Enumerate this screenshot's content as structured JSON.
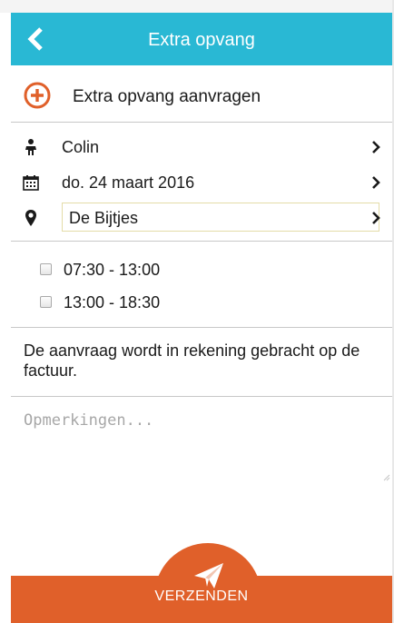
{
  "header": {
    "title": "Extra opvang",
    "back_icon": "chevron-left-icon",
    "background": "#29b8d4"
  },
  "add_request": {
    "label": "Extra opvang aanvragen",
    "icon": "plus-circle-icon",
    "icon_color": "#e0602a"
  },
  "child": {
    "icon": "person-icon",
    "value": "Colin"
  },
  "date": {
    "icon": "calendar-icon",
    "value": "do. 24 maart 2016"
  },
  "location": {
    "icon": "map-pin-icon",
    "value": "De Bijtjes"
  },
  "time_slots": [
    {
      "label": "07:30 - 13:00",
      "checked": false
    },
    {
      "label": "13:00 - 18:30",
      "checked": false
    }
  ],
  "info_text": "De aanvraag wordt in rekening gebracht op de factuur.",
  "remarks": {
    "placeholder": "Opmerkingen...",
    "value": ""
  },
  "submit": {
    "label": "VERZENDEN",
    "icon": "paper-plane-icon",
    "background": "#e0602a"
  }
}
